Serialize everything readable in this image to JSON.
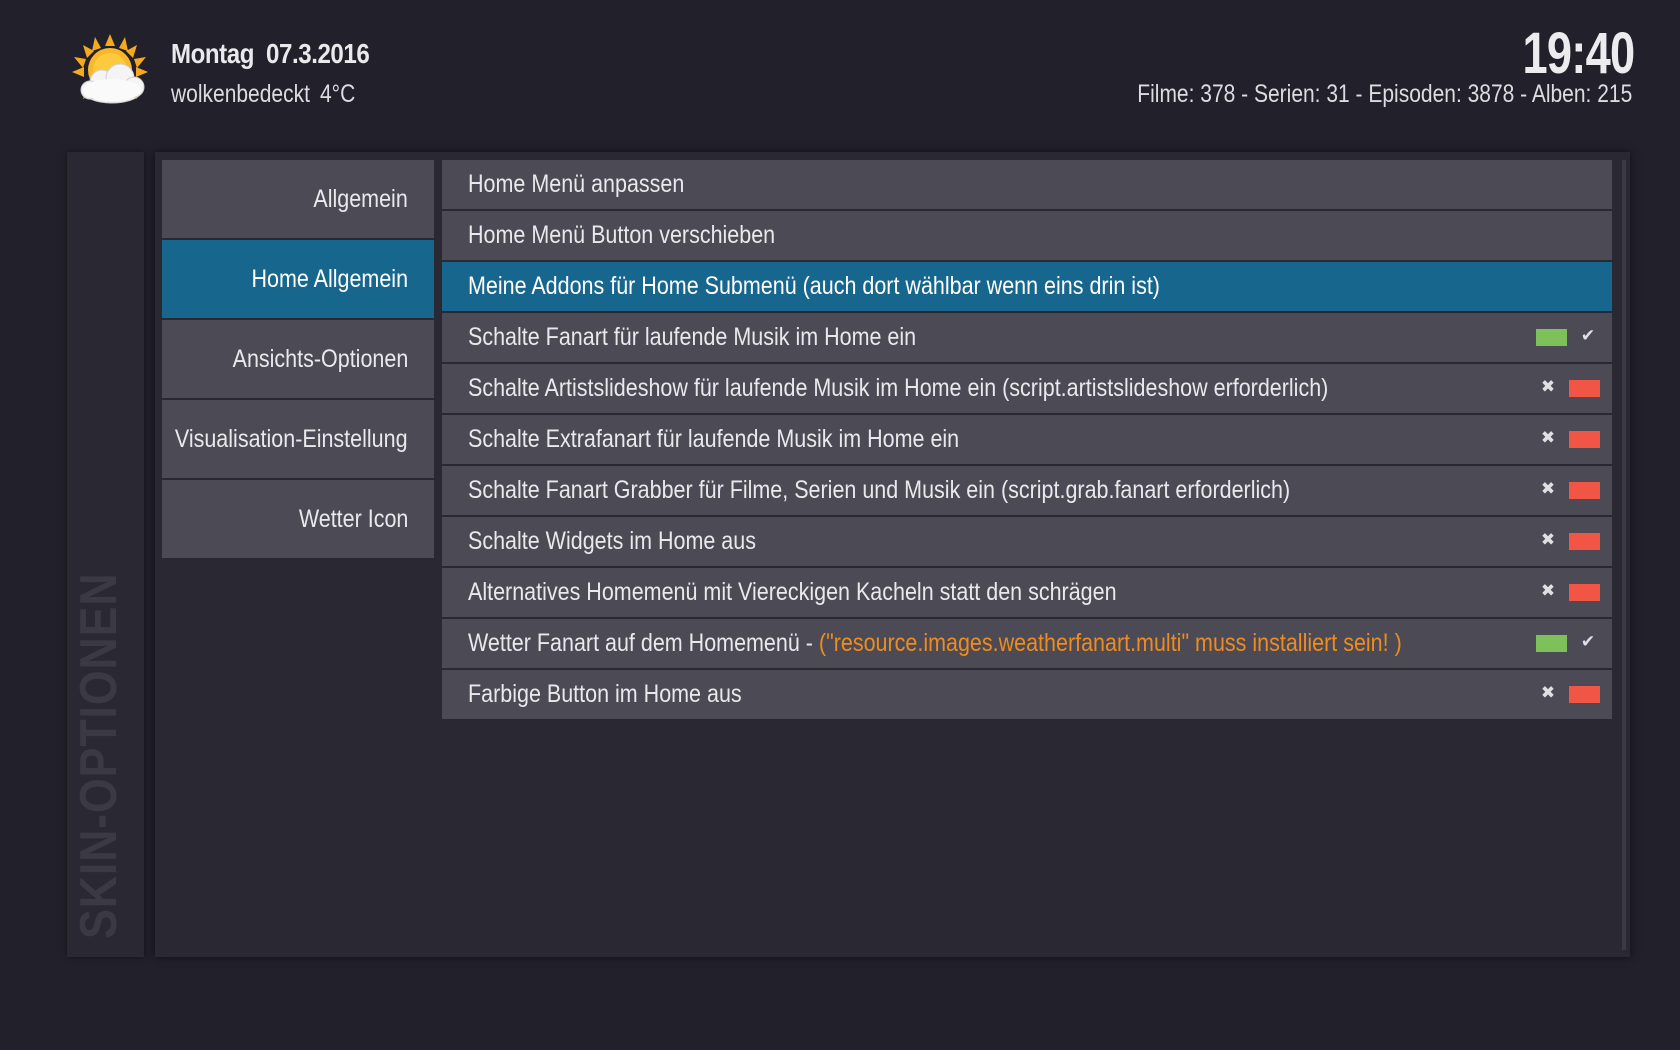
{
  "header": {
    "day": "Montag",
    "date": "07.3.2016",
    "condition": "wolkenbedeckt",
    "temperature": "4°C",
    "weather_icon": "partly-cloudy-sun-icon",
    "clock": "19:40",
    "stats": "Filme: 378 - Serien: 31 - Episoden: 3878 - Alben: 215"
  },
  "sidebar": {
    "title": "SKIN-OPTIONEN"
  },
  "categories": [
    {
      "label": "Allgemein",
      "active": false
    },
    {
      "label": "Home Allgemein",
      "active": true
    },
    {
      "label": "Ansichts-Optionen",
      "active": false
    },
    {
      "label": "Visualisation-Einstellung",
      "active": false
    },
    {
      "label": "Wetter Icon",
      "active": false
    }
  ],
  "options": [
    {
      "label": "Home Menü anpassen",
      "note": "",
      "toggle": null,
      "active": false
    },
    {
      "label": "Home Menü Button verschieben",
      "note": "",
      "toggle": null,
      "active": false
    },
    {
      "label": "Meine Addons für Home Submenü (auch dort wählbar wenn eins drin ist)",
      "note": "",
      "toggle": null,
      "active": true
    },
    {
      "label": "Schalte Fanart für laufende Musik im Home ein",
      "note": "",
      "toggle": true,
      "active": false
    },
    {
      "label": "Schalte Artistslideshow für laufende Musik im Home ein (script.artistslideshow erforderlich)",
      "note": "",
      "toggle": false,
      "active": false
    },
    {
      "label": "Schalte Extrafanart für laufende Musik im Home ein",
      "note": "",
      "toggle": false,
      "active": false
    },
    {
      "label": "Schalte Fanart Grabber für Filme, Serien und Musik ein (script.grab.fanart erforderlich)",
      "note": "",
      "toggle": false,
      "active": false
    },
    {
      "label": "Schalte Widgets im Home aus",
      "note": "",
      "toggle": false,
      "active": false
    },
    {
      "label": "Alternatives Homemenü mit Viereckigen Kacheln statt den schrägen",
      "note": "",
      "toggle": false,
      "active": false
    },
    {
      "label": "Wetter Fanart auf dem Homemenü - ",
      "note": "(\"resource.images.weatherfanart.multi\" muss installiert sein! )",
      "toggle": true,
      "active": false
    },
    {
      "label": "Farbige Button im Home aus",
      "note": "",
      "toggle": false,
      "active": false
    }
  ],
  "toggle_marks": {
    "on": "✔",
    "off": "✖"
  },
  "colors": {
    "background": "#22212b",
    "panel": "#2a2933",
    "item": "#4b4a55",
    "selected": "#17668e",
    "toggle_on": "#7ec15a",
    "toggle_off": "#f05545",
    "warning": "#ef8c1f"
  }
}
